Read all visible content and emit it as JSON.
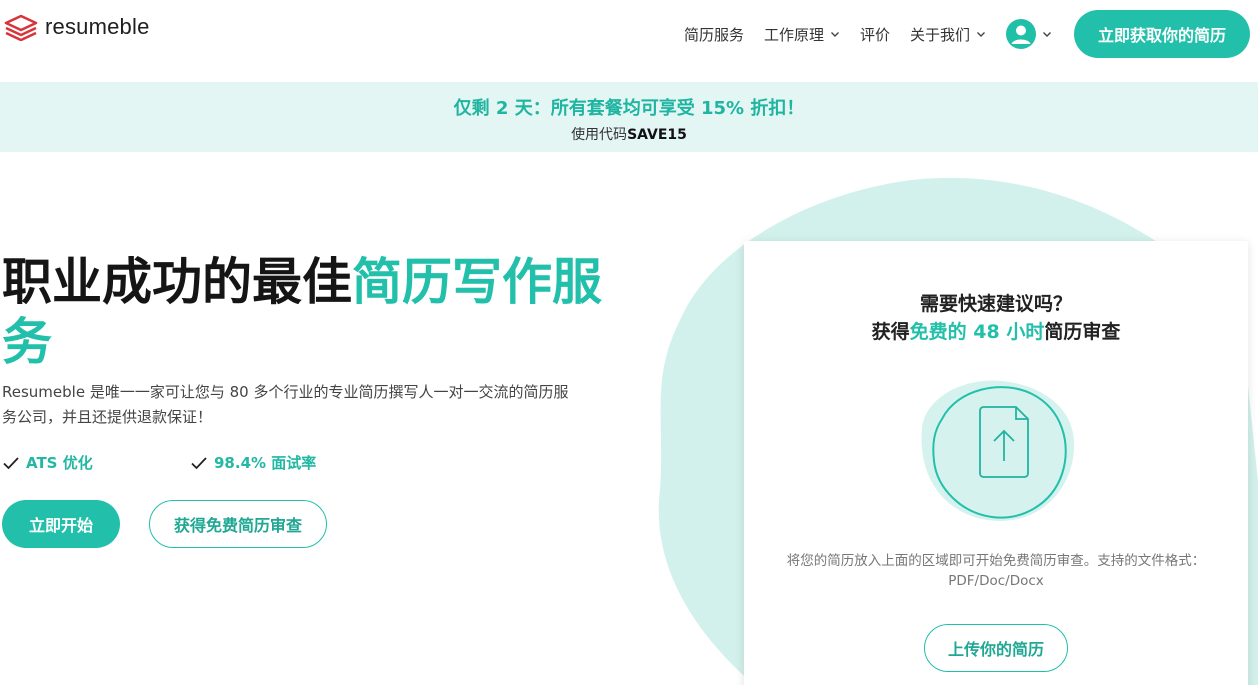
{
  "brand": {
    "name": "resumeble",
    "color_primary": "#22c0aa",
    "color_logo": "#d6363b"
  },
  "nav": {
    "items": [
      {
        "label": "简历服务",
        "has_dropdown": false
      },
      {
        "label": "工作原理",
        "has_dropdown": true
      },
      {
        "label": "评价",
        "has_dropdown": false
      },
      {
        "label": "关于我们",
        "has_dropdown": true
      }
    ],
    "account_icon": "user-icon",
    "cta_label": "立即获取你的简历"
  },
  "promo": {
    "title": "仅剩 2 天：所有套餐均可享受 15% 折扣！",
    "code_prefix": "使用代码",
    "code": "SAVE15"
  },
  "hero": {
    "title_part1": "职业成功的最佳",
    "title_accent": "简历写作服务",
    "description": "Resumeble 是唯一一家可让您与 80 多个行业的专业简历撰写人一对一交流的简历服务公司，并且还提供退款保证！",
    "features": [
      "ATS 优化",
      "98.4% 面试率"
    ],
    "primary_button": "立即开始",
    "secondary_button": "获得免费简历审查"
  },
  "card": {
    "question": "需要快速建议吗？",
    "offer_prefix": "获得",
    "offer_accent": "免费的 48 小时",
    "offer_suffix": "简历审查",
    "upload_icon": "file-upload-icon",
    "help_text": "将您的简历放入上面的区域即可开始免费简历审查。支持的文件格式：PDF/Doc/Docx",
    "upload_button": "上传你的简历"
  }
}
